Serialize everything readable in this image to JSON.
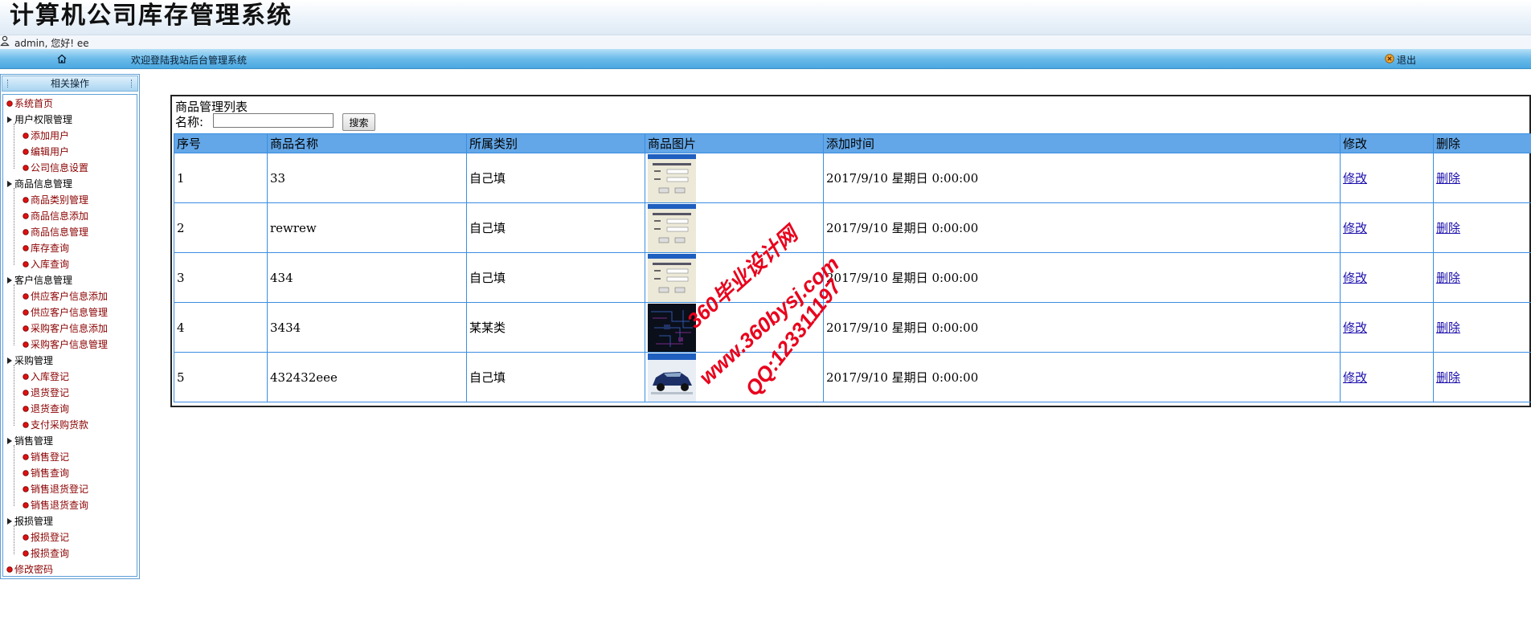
{
  "header": {
    "app_title": "计算机公司库存管理系统",
    "user_greeting": "admin, 您好! ee"
  },
  "navbar": {
    "welcome": "欢迎登陆我站后台管理系统",
    "logout_label": "退出"
  },
  "sidebar": {
    "title": "相关操作",
    "tree": [
      {
        "label": "系统首页",
        "kind": "top",
        "icon": "red-node-icon"
      },
      {
        "label": "用户权限管理",
        "kind": "root",
        "icon": "expand-arrow-icon",
        "children": [
          {
            "label": "添加用户"
          },
          {
            "label": "编辑用户"
          },
          {
            "label": "公司信息设置"
          }
        ]
      },
      {
        "label": "商品信息管理",
        "kind": "root",
        "icon": "expand-arrow-icon",
        "children": [
          {
            "label": "商品类别管理"
          },
          {
            "label": "商品信息添加"
          },
          {
            "label": "商品信息管理"
          },
          {
            "label": "库存查询"
          },
          {
            "label": "入库查询"
          }
        ]
      },
      {
        "label": "客户信息管理",
        "kind": "root",
        "icon": "expand-arrow-icon",
        "children": [
          {
            "label": "供应客户信息添加"
          },
          {
            "label": "供应客户信息管理"
          },
          {
            "label": "采购客户信息添加"
          },
          {
            "label": "采购客户信息管理"
          }
        ]
      },
      {
        "label": "采购管理",
        "kind": "root",
        "icon": "expand-arrow-icon",
        "children": [
          {
            "label": "入库登记"
          },
          {
            "label": "退货登记"
          },
          {
            "label": "退货查询"
          },
          {
            "label": "支付采购货款"
          }
        ]
      },
      {
        "label": "销售管理",
        "kind": "root",
        "icon": "expand-arrow-icon",
        "children": [
          {
            "label": "销售登记"
          },
          {
            "label": "销售查询"
          },
          {
            "label": "销售退货登记"
          },
          {
            "label": "销售退货查询"
          }
        ]
      },
      {
        "label": "报损管理",
        "kind": "root",
        "icon": "expand-arrow-icon",
        "children": [
          {
            "label": "报损登记"
          },
          {
            "label": "报损查询"
          }
        ]
      },
      {
        "label": "修改密码",
        "kind": "top",
        "icon": "red-node-icon"
      }
    ]
  },
  "main": {
    "list_title": "商品管理列表",
    "search_label": "名称:",
    "search_value": "",
    "search_button": "搜索",
    "columns": [
      "序号",
      "商品名称",
      "所属类别",
      "商品图片",
      "添加时间",
      "修改",
      "删除"
    ],
    "rows": [
      {
        "id": "1",
        "name": "33",
        "category": "自己填",
        "image": "dialog-screenshot-thumbnail",
        "time": "2017/9/10 星期日 0:00:00",
        "edit": "修改",
        "delete": "删除"
      },
      {
        "id": "2",
        "name": "rewrew",
        "category": "自己填",
        "image": "dialog-screenshot-thumbnail",
        "time": "2017/9/10 星期日 0:00:00",
        "edit": "修改",
        "delete": "删除"
      },
      {
        "id": "3",
        "name": "434",
        "category": "自己填",
        "image": "dialog-screenshot-thumbnail",
        "time": "2017/9/10 星期日 0:00:00",
        "edit": "修改",
        "delete": "删除"
      },
      {
        "id": "4",
        "name": "3434",
        "category": "某某类",
        "image": "dark-circuit-thumbnail",
        "time": "2017/9/10 星期日 0:00:00",
        "edit": "修改",
        "delete": "删除"
      },
      {
        "id": "5",
        "name": "432432eee",
        "category": "自己填",
        "image": "blue-car-thumbnail",
        "time": "2017/9/10 星期日 0:00:00",
        "edit": "修改",
        "delete": "删除"
      }
    ]
  },
  "watermark": {
    "lines": [
      "360毕业设计网",
      "www.360bysj.com",
      "QQ:123311197"
    ],
    "color": "#e8001c"
  },
  "colors": {
    "nav_blue": "#4aa7e0",
    "table_header": "#63a7e8",
    "table_border": "#3b8ee0",
    "tree_leaf_text": "#8b0000",
    "link": "#1a0dab"
  }
}
